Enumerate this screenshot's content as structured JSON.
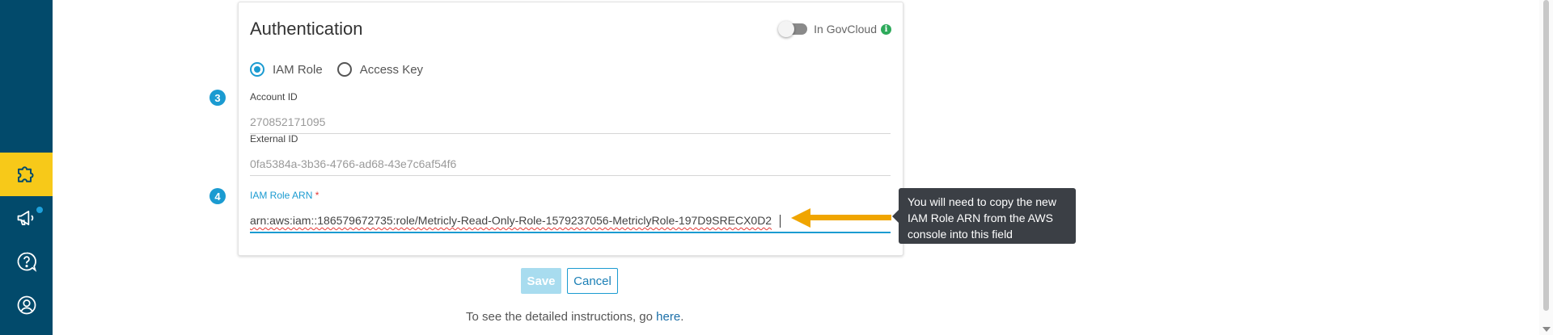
{
  "sidebar": {
    "items": [
      {
        "icon": "puzzle-icon",
        "active": true
      },
      {
        "icon": "megaphone-icon",
        "notification": true
      },
      {
        "icon": "help-icon"
      },
      {
        "icon": "user-icon"
      }
    ],
    "colors": {
      "background": "#024a6b",
      "active": "#f7c919"
    }
  },
  "card": {
    "title": "Authentication",
    "govcloud_label": "In GovCloud",
    "govcloud_enabled": false,
    "info_glyph": "i",
    "radio_options": [
      {
        "label": "IAM Role",
        "selected": true
      },
      {
        "label": "Access Key",
        "selected": false
      }
    ],
    "fields": {
      "account_id": {
        "label": "Account ID",
        "value": "270852171095"
      },
      "external_id": {
        "label": "External ID",
        "value": "0fa5384a-3b36-4766-ad68-43e7c6af54f6"
      },
      "iam_role_arn": {
        "label": "IAM Role ARN",
        "required_mark": "*",
        "value": "arn:aws:iam::186579672735:role/Metricly-Read-Only-Role-1579237056-MetriclyRole-197D9SRECX0D2"
      }
    }
  },
  "steps": [
    "3",
    "4"
  ],
  "tooltip": {
    "text": "You will need to copy the new IAM Role ARN from the AWS console into this field"
  },
  "actions": {
    "save_label": "Save",
    "cancel_label": "Cancel"
  },
  "instructions": {
    "prefix": "To see the detailed instructions, go ",
    "link": "here",
    "suffix": "."
  },
  "colors": {
    "accent": "#1b9bd1",
    "arrow": "#f0a500",
    "tooltip_bg": "#3b3f45"
  }
}
